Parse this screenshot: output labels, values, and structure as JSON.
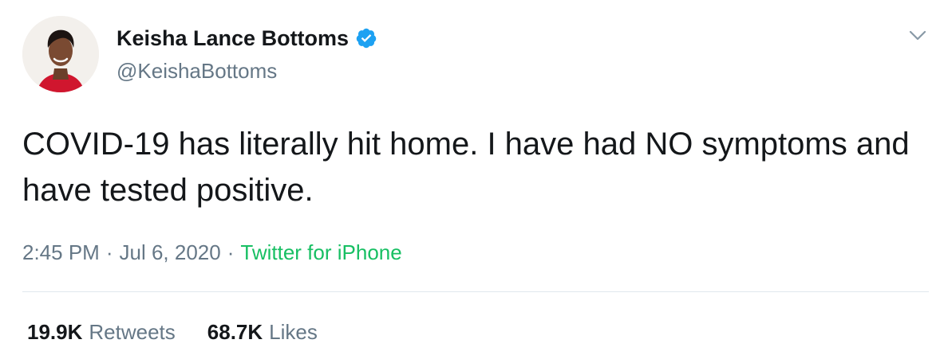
{
  "author": {
    "name": "Keisha Lance Bottoms",
    "handle": "@KeishaBottoms",
    "verified": true
  },
  "tweet": {
    "text": "COVID-19 has literally hit home. I have had NO symptoms and have tested positive.",
    "time": "2:45 PM",
    "separator": "·",
    "date": "Jul 6, 2020",
    "source": "Twitter for iPhone"
  },
  "stats": {
    "retweets_count": "19.9K",
    "retweets_label": "Retweets",
    "likes_count": "68.7K",
    "likes_label": "Likes"
  },
  "icons": {
    "verified": "verified-badge-icon",
    "menu": "chevron-down-icon"
  },
  "colors": {
    "text_primary": "#14171a",
    "text_secondary": "#657786",
    "source_link": "#17bf63",
    "verified_badge": "#1da1f2",
    "divider": "#e1e8ed"
  }
}
